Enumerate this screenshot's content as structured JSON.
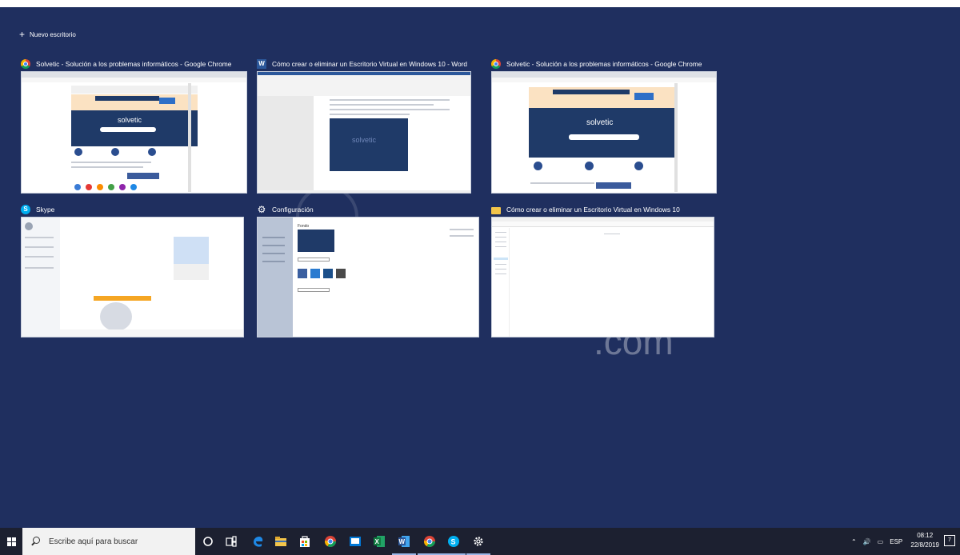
{
  "desktop": {
    "new_desktop_label": "Nuevo escritorio",
    "watermark_text": ".com",
    "windows": [
      {
        "title": "Solvetic - Solución a los problemas informáticos - Google Chrome",
        "app_icon": "chrome-icon"
      },
      {
        "title": "Cómo crear o eliminar un Escritorio Virtual en Windows 10 - Word",
        "app_icon": "word-icon"
      },
      {
        "title": "Solvetic - Solución a los problemas informáticos - Google Chrome",
        "app_icon": "chrome-icon"
      },
      {
        "title": "Skype",
        "app_icon": "skype-icon"
      },
      {
        "title": "Configuración",
        "app_icon": "gear-icon"
      },
      {
        "title": "Cómo crear o eliminar un Escritorio Virtual en Windows 10",
        "app_icon": "folder-icon"
      }
    ],
    "thumb_text": {
      "solvetic_logo": "solvetic",
      "fondo": "Fondo"
    }
  },
  "taskbar": {
    "search_placeholder": "Escribe aquí para buscar",
    "language": "ESP",
    "time": "08:12",
    "date": "22/8/2019",
    "notification_count": "7",
    "pinned": [
      "cortana-icon",
      "task-view-icon",
      "edge-icon",
      "file-explorer-icon",
      "store-icon",
      "chrome-icon",
      "mail-icon",
      "excel-icon",
      "word-icon",
      "chrome-icon",
      "skype-icon",
      "settings-icon"
    ]
  },
  "colors": {
    "desktop_bg": "#1f2f5f",
    "taskbar_bg": "#1c2030",
    "solvetic_blue": "#1f3a68"
  }
}
